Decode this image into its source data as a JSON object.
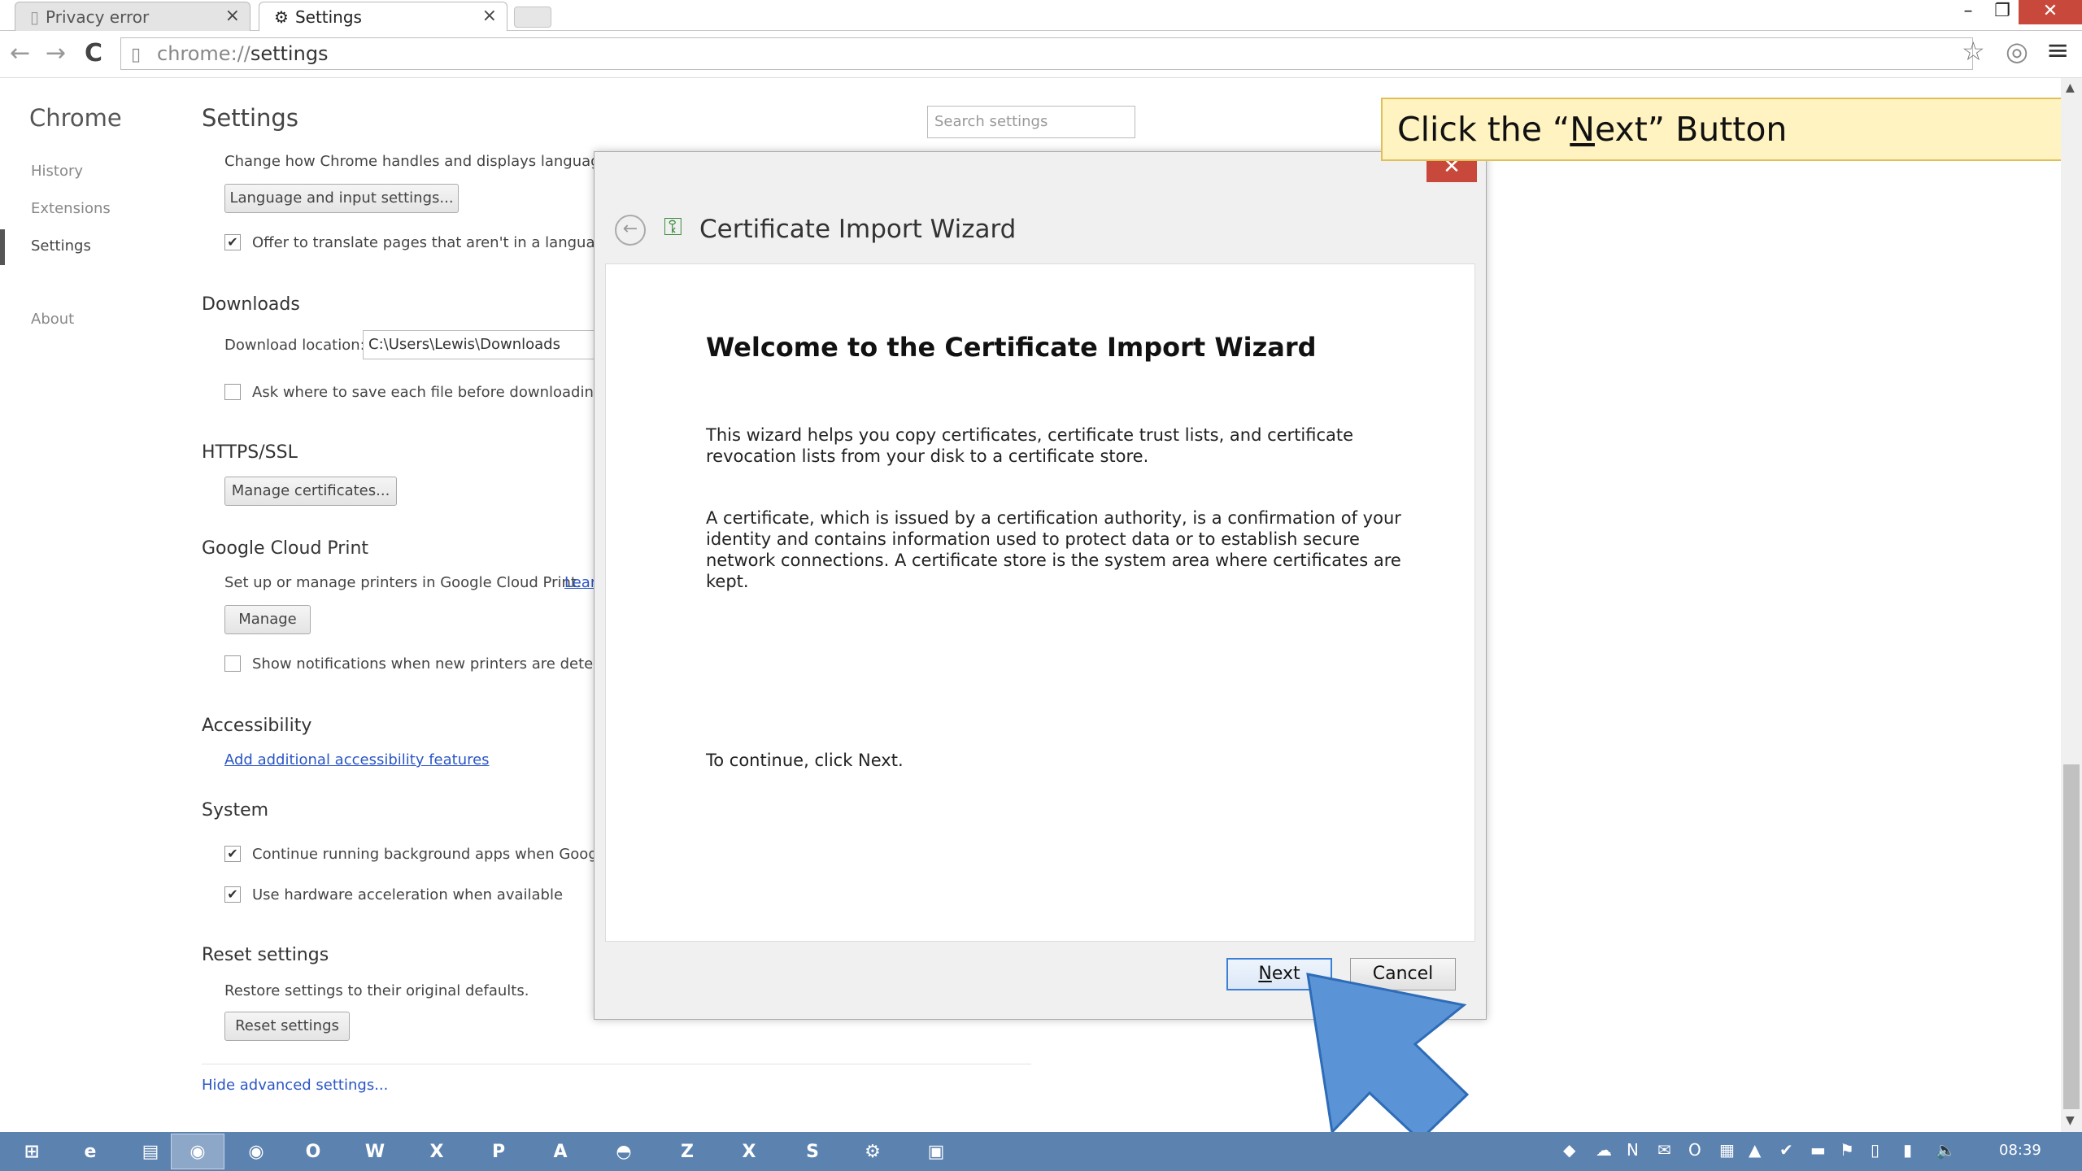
{
  "tabs": [
    {
      "label": "Privacy error",
      "close": "×"
    },
    {
      "label": "Settings",
      "close": "×"
    }
  ],
  "window": {
    "min": "–",
    "max": "❐",
    "close": "✕"
  },
  "toolbar": {
    "back": "←",
    "forward": "→",
    "reload": "C",
    "url_prefix": "chrome://",
    "url_rest": "settings",
    "star": "☆",
    "menu": "≡"
  },
  "nav": {
    "title": "Chrome",
    "items": [
      "History",
      "Extensions",
      "Settings",
      "About"
    ]
  },
  "page": {
    "title": "Settings",
    "search_placeholder": "Search settings"
  },
  "languages": {
    "desc": "Change how Chrome handles and displays languages.",
    "button": "Language and input settings...",
    "translate": "Offer to translate pages that aren't in a language"
  },
  "downloads": {
    "heading": "Downloads",
    "location_label": "Download location:",
    "location_value": "C:\\Users\\Lewis\\Downloads",
    "ask": "Ask where to save each file before downloading"
  },
  "https": {
    "heading": "HTTPS/SSL",
    "button": "Manage certificates..."
  },
  "cloud_print": {
    "heading": "Google Cloud Print",
    "desc": "Set up or manage printers in Google Cloud Print.",
    "link": "Lear",
    "button": "Manage",
    "notify": "Show notifications when new printers are detecte"
  },
  "accessibility": {
    "heading": "Accessibility",
    "link": "Add additional accessibility features"
  },
  "system": {
    "heading": "System",
    "bg_apps": "Continue running background apps when Google",
    "hw_accel": "Use hardware acceleration when available"
  },
  "reset": {
    "heading": "Reset settings",
    "desc": "Restore settings to their original defaults.",
    "button": "Reset settings"
  },
  "hide_advanced": "Hide advanced settings...",
  "dialog": {
    "close": "✕",
    "back": "←",
    "title": "Certificate Import Wizard",
    "heading": "Welcome to the Certificate Import Wizard",
    "p1": "This wizard helps you copy certificates, certificate trust lists, and certificate revocation lists from your disk to a certificate store.",
    "p2": "A certificate, which is issued by a certification authority, is a confirmation of your identity and contains information used to protect data or to establish secure network connections. A certificate store is the system area where certificates are kept.",
    "p3": "To continue, click Next.",
    "next_mnemonic": "N",
    "next_rest": "ext",
    "cancel": "Cancel"
  },
  "callout": {
    "before": "Click the “",
    "mnemonic": "N",
    "after": "ext” Button"
  },
  "taskbar": {
    "items": [
      "⊞",
      "e",
      "▤",
      "◉",
      "◉",
      "O",
      "W",
      "X",
      "P",
      "A",
      "◓",
      "Z",
      "X",
      "S",
      "⚙",
      "▣"
    ],
    "tray": [
      "◆",
      "☁",
      "N",
      "✉",
      "O",
      "▦",
      "▲",
      "✔",
      "▬",
      "⚑",
      "▯",
      "▮",
      "🔈"
    ],
    "clock": "08:39"
  }
}
